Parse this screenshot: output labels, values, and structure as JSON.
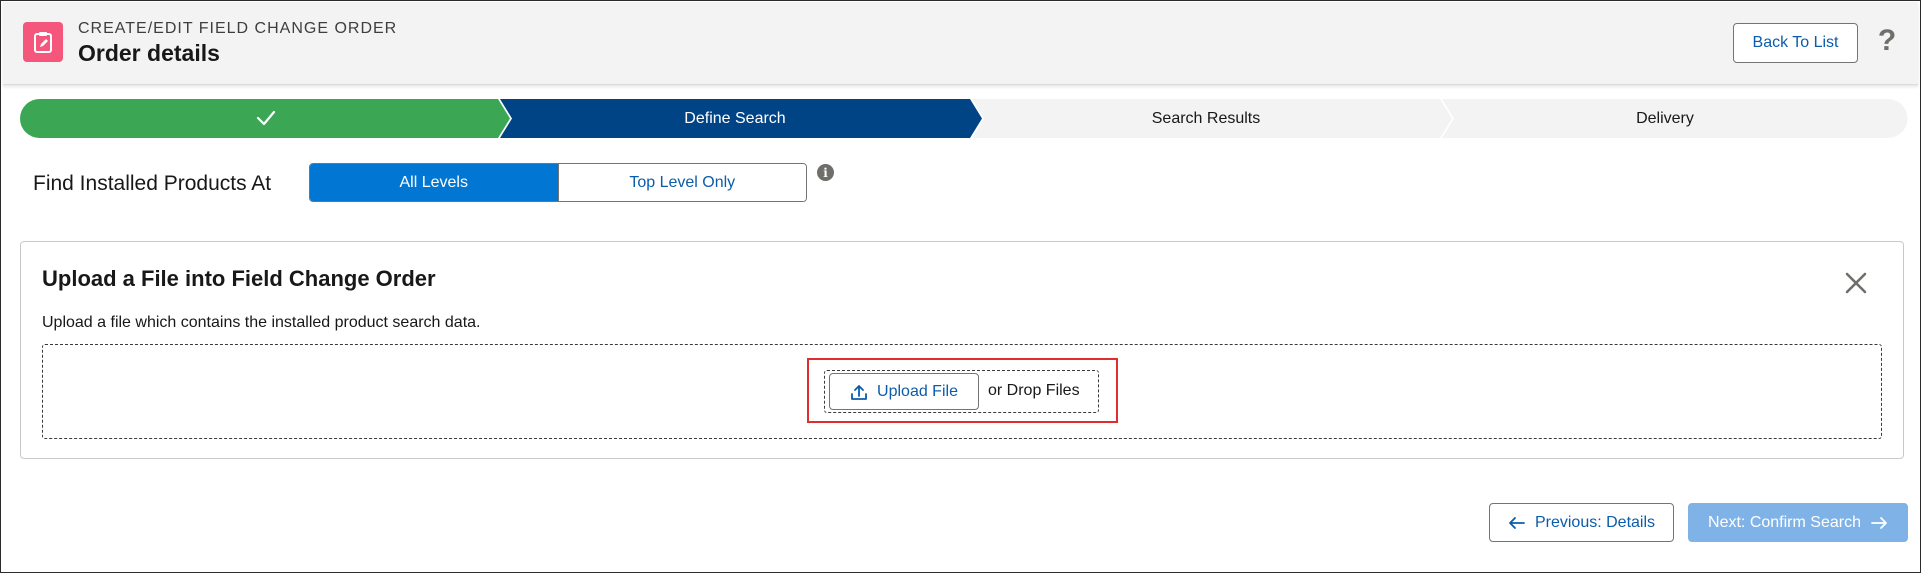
{
  "header": {
    "eyebrow": "CREATE/EDIT FIELD CHANGE ORDER",
    "title": "Order details",
    "back_label": "Back To List",
    "help_glyph": "?",
    "icon": "edit-form-icon",
    "icon_color": "#f4567c"
  },
  "path": {
    "steps": [
      {
        "label": "",
        "status": "complete",
        "icon": "check-icon",
        "color": "#3ba755"
      },
      {
        "label": "Define Search",
        "status": "current",
        "color": "#014486"
      },
      {
        "label": "Search Results",
        "status": "incomplete",
        "color": "#f3f3f3"
      },
      {
        "label": "Delivery",
        "status": "incomplete",
        "color": "#f3f3f3"
      }
    ]
  },
  "find": {
    "label": "Find Installed Products At",
    "options": [
      "All Levels",
      "Top Level Only"
    ],
    "selected": "All Levels",
    "info_glyph": "i"
  },
  "upload_card": {
    "title": "Upload a File into Field Change Order",
    "description": "Upload a file which contains the installed product search data.",
    "upload_label": "Upload File",
    "drop_label": "or Drop Files",
    "highlight_color": "#e02d2d"
  },
  "footer": {
    "previous_label": "Previous: Details",
    "next_label": "Next: Confirm Search",
    "next_color": "#7fb3e8"
  },
  "colors": {
    "brand": "#0176d3",
    "link": "#0b5cab"
  }
}
